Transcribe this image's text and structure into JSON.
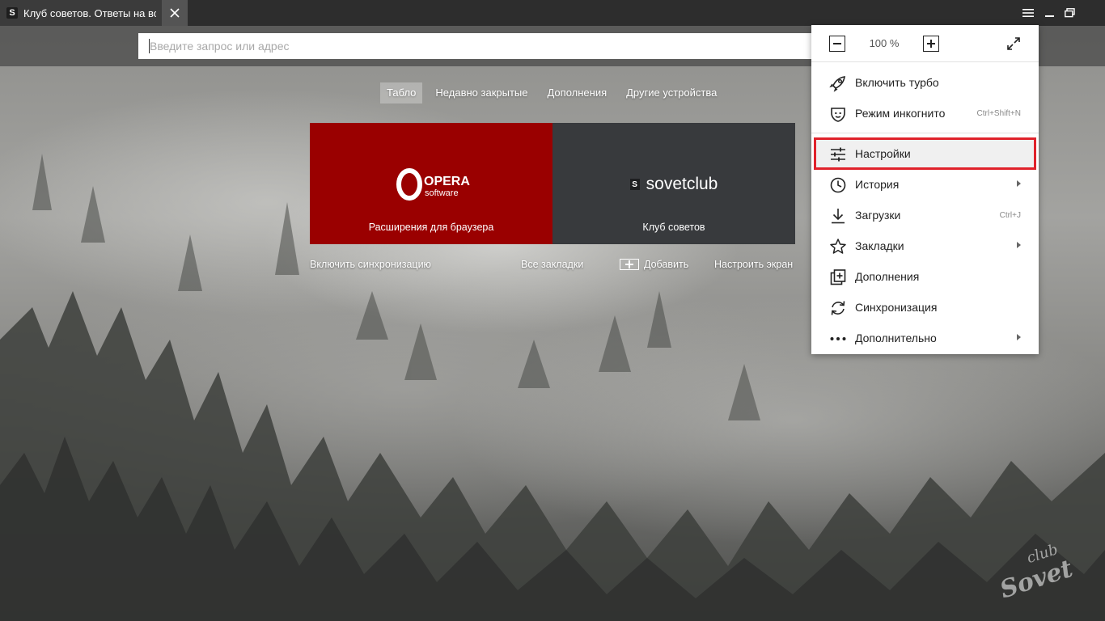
{
  "tab": {
    "favicon": "S",
    "title": "Клуб советов. Ответы на вопросы"
  },
  "window_controls": [
    "menu-icon",
    "minimize-icon",
    "restore-icon"
  ],
  "omnibox": {
    "placeholder": "Введите запрос или адрес",
    "value": ""
  },
  "nav_tabs": [
    {
      "label": "Табло",
      "active": true
    },
    {
      "label": "Недавно закрытые",
      "active": false
    },
    {
      "label": "Дополнения",
      "active": false
    },
    {
      "label": "Другие устройства",
      "active": false
    }
  ],
  "tiles": [
    {
      "logo_main": "OPERA",
      "logo_sub": "software",
      "caption": "Расширения для браузера",
      "color": "#9a0000"
    },
    {
      "badge": "S",
      "logo_text": "sovetclub",
      "caption": "Клуб советов",
      "color": "#383a3d"
    }
  ],
  "bottom_links": {
    "sync": "Включить синхронизацию",
    "bookmarks": "Все закладки",
    "add": "Добавить",
    "customize": "Настроить экран"
  },
  "menu": {
    "zoom_level": "100 %",
    "items": [
      {
        "label": "Включить турбо",
        "icon": "rocket-icon",
        "shortcut": "",
        "submenu": false
      },
      {
        "label": "Режим инкогнито",
        "icon": "incognito-mask-icon",
        "shortcut": "Ctrl+Shift+N",
        "submenu": false
      },
      {
        "label": "Настройки",
        "icon": "settings-sliders-icon",
        "shortcut": "",
        "submenu": false,
        "highlighted": true
      },
      {
        "label": "История",
        "icon": "clock-icon",
        "shortcut": "",
        "submenu": true
      },
      {
        "label": "Загрузки",
        "icon": "download-icon",
        "shortcut": "Ctrl+J",
        "submenu": false
      },
      {
        "label": "Закладки",
        "icon": "star-icon",
        "shortcut": "",
        "submenu": true
      },
      {
        "label": "Дополнения",
        "icon": "extensions-icon",
        "shortcut": "",
        "submenu": false
      },
      {
        "label": "Синхронизация",
        "icon": "sync-icon",
        "shortcut": "",
        "submenu": false
      },
      {
        "label": "Дополнительно",
        "icon": "more-dots-icon",
        "shortcut": "",
        "submenu": true
      }
    ]
  },
  "colors": {
    "highlight_border": "#e0222b",
    "opera_tile": "#9a0000",
    "sovet_tile": "#383a3d"
  },
  "watermark": {
    "line1": "club",
    "line2": "Sovet"
  }
}
